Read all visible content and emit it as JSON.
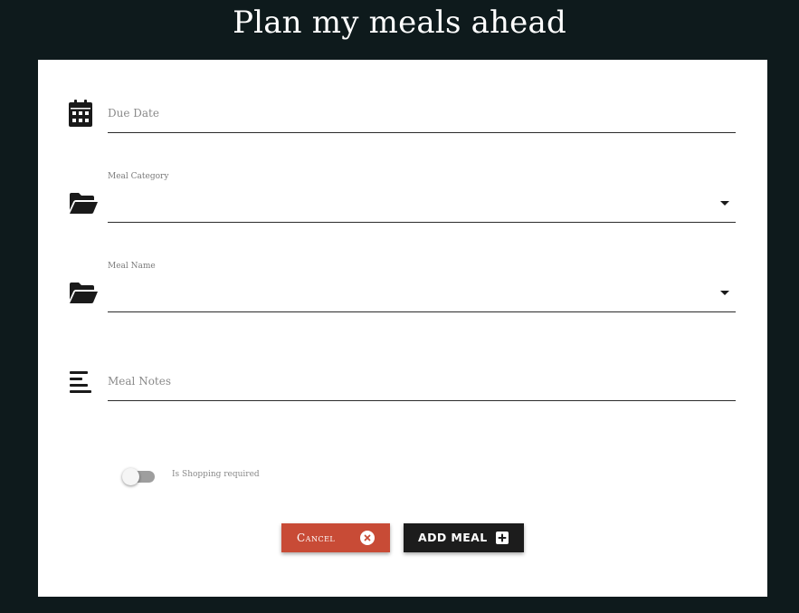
{
  "page": {
    "title": "Plan my meals ahead"
  },
  "form": {
    "due_date": {
      "placeholder": "Due Date",
      "icon": "calendar-icon"
    },
    "meal_category": {
      "label": "Meal Category",
      "value": "",
      "icon": "folder-open-icon"
    },
    "meal_name": {
      "label": "Meal Name",
      "value": "",
      "icon": "folder-open-icon"
    },
    "meal_notes": {
      "placeholder": "Meal Notes",
      "icon": "align-left-icon"
    },
    "shopping_toggle": {
      "label": "Is Shopping required",
      "checked": false
    }
  },
  "actions": {
    "cancel_label": "Cancel",
    "cancel_icon": "close-circle-icon",
    "add_label": "ADD MEAL",
    "add_icon": "plus-square-icon"
  },
  "colors": {
    "background": "#0e1a1c",
    "card": "#ffffff",
    "cancel": "#c84b36",
    "add": "#1c1c1c"
  }
}
